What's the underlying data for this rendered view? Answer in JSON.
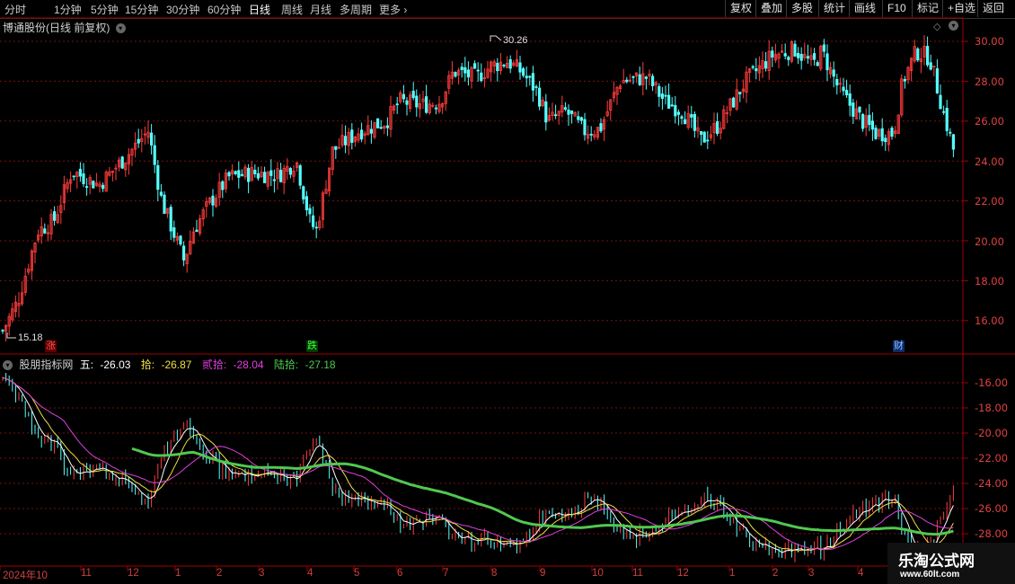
{
  "toolbar": {
    "periods": [
      "分时",
      "1分钟",
      "5分钟",
      "15分钟",
      "30分钟",
      "60分钟",
      "日线",
      "周线",
      "月线",
      "多周期",
      "更多"
    ],
    "active_period": "日线",
    "right_buttons": [
      "复权",
      "叠加",
      "多股",
      "统计",
      "画线",
      "F10",
      "标记",
      "+自选",
      "返回"
    ]
  },
  "main_chart": {
    "title": "博通股份(日线 前复权)",
    "high_label": "30.26",
    "low_label": "15.18",
    "price_ticks": [
      "30.00",
      "28.00",
      "26.00",
      "24.00",
      "22.00",
      "20.00",
      "18.00",
      "16.00"
    ],
    "markers": [
      {
        "text": "涨",
        "color": "#c83232"
      },
      {
        "text": "跌",
        "color": "#2ec82e"
      },
      {
        "text": "财",
        "color": "#3a7ae0"
      }
    ]
  },
  "indicator": {
    "name": "股朋指标网",
    "lines": [
      {
        "label": "五:",
        "value": "-26.03",
        "color": "#ffffff"
      },
      {
        "label": "拾:",
        "value": "-26.87",
        "color": "#f0e040"
      },
      {
        "label": "贰拾:",
        "value": "-28.04",
        "color": "#e040e0"
      },
      {
        "label": "陆拾:",
        "value": "-27.18",
        "color": "#50c850"
      }
    ],
    "ticks": [
      "-16.00",
      "-18.00",
      "-20.00",
      "-22.00",
      "-24.00",
      "-26.00",
      "-28.00"
    ]
  },
  "x_axis": {
    "months": [
      "2024年10",
      "11",
      "12",
      "1",
      "2",
      "3",
      "4",
      "5",
      "6",
      "7",
      "8",
      "9",
      "10",
      "11",
      "12",
      "1",
      "2",
      "3",
      "4"
    ]
  },
  "watermark": {
    "line1": "乐淘公式网",
    "line2": "www.60lt.com"
  },
  "colors": {
    "up": "#ff3c3c",
    "down": "#54ffff",
    "grid": "#7a1010",
    "axis": "#a00000"
  }
}
